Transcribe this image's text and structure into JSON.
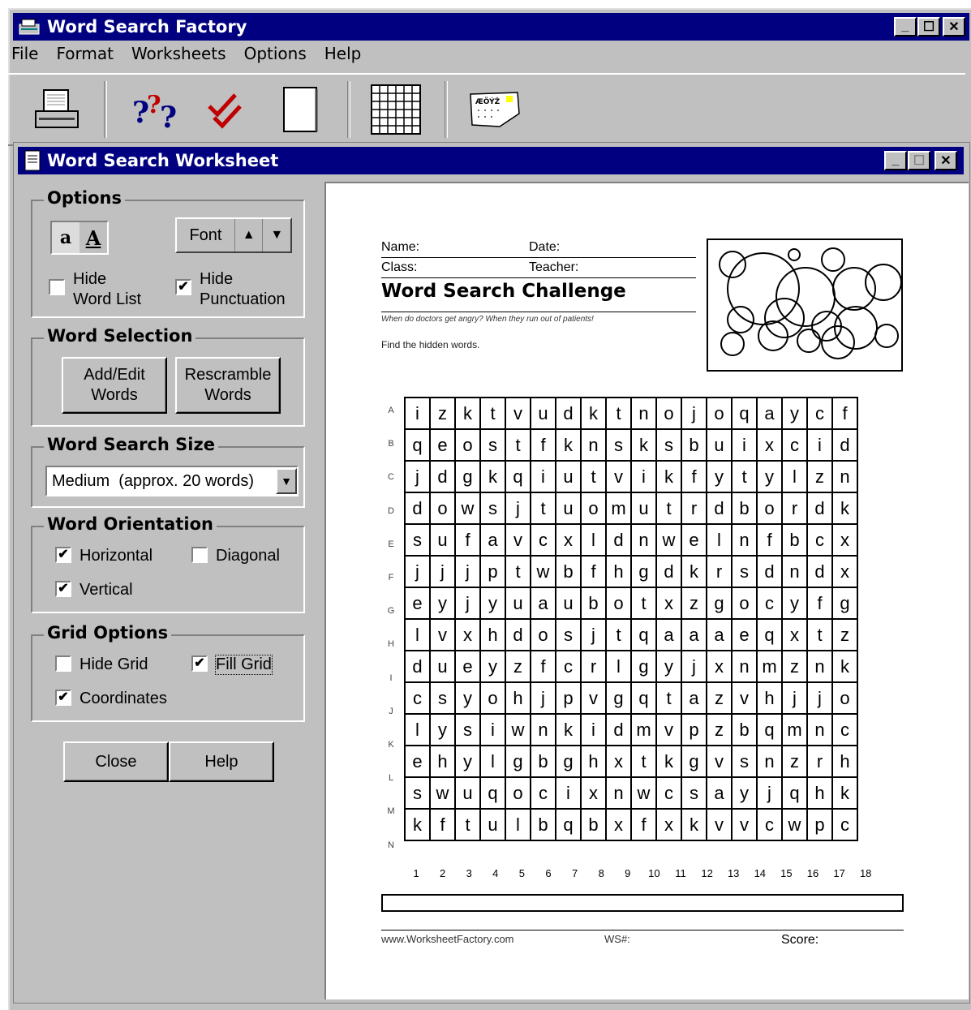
{
  "app": {
    "title": "Word Search Factory"
  },
  "menu": [
    "File",
    "Format",
    "Worksheets",
    "Options",
    "Help"
  ],
  "toolbar": {
    "buttons": [
      "printer-icon",
      "question-marks-icon",
      "checkmarks-icon",
      "blank-page-icon",
      "grid-icon",
      "worksheet-icon"
    ]
  },
  "worksheet_window": {
    "title": "Word Search Worksheet"
  },
  "options": {
    "group_label": "Options",
    "case_small": "a",
    "case_large": "A",
    "font_label": "Font",
    "hide_word_list": {
      "line1": "Hide",
      "line2": "Word List",
      "checked": false
    },
    "hide_punctuation": {
      "line1": "Hide",
      "line2": "Punctuation",
      "checked": true
    }
  },
  "word_selection": {
    "group_label": "Word Selection",
    "add_edit": {
      "line1": "Add/Edit",
      "line2": "Words"
    },
    "rescramble": {
      "line1": "Rescramble",
      "line2": "Words"
    }
  },
  "word_search_size": {
    "group_label": "Word Search Size",
    "selected": "Medium  (approx. 20 words)"
  },
  "word_orientation": {
    "group_label": "Word Orientation",
    "horizontal": {
      "label": "Horizontal",
      "checked": true
    },
    "diagonal": {
      "label": "Diagonal",
      "checked": false
    },
    "vertical": {
      "label": "Vertical",
      "checked": true
    }
  },
  "grid_options": {
    "group_label": "Grid Options",
    "hide_grid": {
      "label": "Hide Grid",
      "checked": false
    },
    "fill_grid": {
      "label": "Fill Grid",
      "checked": true
    },
    "coordinates": {
      "label": "Coordinates",
      "checked": true
    }
  },
  "bottom_buttons": {
    "close": "Close",
    "help": "Help"
  },
  "sheet": {
    "name_label": "Name:",
    "date_label": "Date:",
    "class_label": "Class:",
    "teacher_label": "Teacher:",
    "title": "Word Search Challenge",
    "subtitle": "When do doctors get angry? When they run out of patients!",
    "instructions": "Find the hidden words.",
    "footer_site": "www.WorksheetFactory.com",
    "footer_ws": "WS#:",
    "footer_score": "Score:",
    "row_labels": [
      "A",
      "B",
      "C",
      "D",
      "E",
      "F",
      "G",
      "H",
      "I",
      "J",
      "K",
      "L",
      "M",
      "N"
    ],
    "col_labels": [
      "1",
      "2",
      "3",
      "4",
      "5",
      "6",
      "7",
      "8",
      "9",
      "10",
      "11",
      "12",
      "13",
      "14",
      "15",
      "16",
      "17",
      "18"
    ],
    "grid": [
      [
        "i",
        "z",
        "k",
        "t",
        "v",
        "u",
        "d",
        "k",
        "t",
        "n",
        "o",
        "j",
        "o",
        "q",
        "a",
        "y",
        "c",
        "f"
      ],
      [
        "q",
        "e",
        "o",
        "s",
        "t",
        "f",
        "k",
        "n",
        "s",
        "k",
        "s",
        "b",
        "u",
        "i",
        "x",
        "c",
        "i",
        "d"
      ],
      [
        "j",
        "d",
        "g",
        "k",
        "q",
        "i",
        "u",
        "t",
        "v",
        "i",
        "k",
        "f",
        "y",
        "t",
        "y",
        "l",
        "z",
        "n"
      ],
      [
        "d",
        "o",
        "w",
        "s",
        "j",
        "t",
        "u",
        "o",
        "m",
        "u",
        "t",
        "r",
        "d",
        "b",
        "o",
        "r",
        "d",
        "k"
      ],
      [
        "s",
        "u",
        "f",
        "a",
        "v",
        "c",
        "x",
        "l",
        "d",
        "n",
        "w",
        "e",
        "l",
        "n",
        "f",
        "b",
        "c",
        "x"
      ],
      [
        "j",
        "j",
        "j",
        "p",
        "t",
        "w",
        "b",
        "f",
        "h",
        "g",
        "d",
        "k",
        "r",
        "s",
        "d",
        "n",
        "d",
        "x"
      ],
      [
        "e",
        "y",
        "j",
        "y",
        "u",
        "a",
        "u",
        "b",
        "o",
        "t",
        "x",
        "z",
        "g",
        "o",
        "c",
        "y",
        "f",
        "g"
      ],
      [
        "l",
        "v",
        "x",
        "h",
        "d",
        "o",
        "s",
        "j",
        "t",
        "q",
        "a",
        "a",
        "a",
        "e",
        "q",
        "x",
        "t",
        "z"
      ],
      [
        "d",
        "u",
        "e",
        "y",
        "z",
        "f",
        "c",
        "r",
        "l",
        "g",
        "y",
        "j",
        "x",
        "n",
        "m",
        "z",
        "n",
        "k"
      ],
      [
        "c",
        "s",
        "y",
        "o",
        "h",
        "j",
        "p",
        "v",
        "g",
        "q",
        "t",
        "a",
        "z",
        "v",
        "h",
        "j",
        "j",
        "o"
      ],
      [
        "l",
        "y",
        "s",
        "i",
        "w",
        "n",
        "k",
        "i",
        "d",
        "m",
        "v",
        "p",
        "z",
        "b",
        "q",
        "m",
        "n",
        "c"
      ],
      [
        "e",
        "h",
        "y",
        "l",
        "g",
        "b",
        "g",
        "h",
        "x",
        "t",
        "k",
        "g",
        "v",
        "s",
        "n",
        "z",
        "r",
        "h"
      ],
      [
        "s",
        "w",
        "u",
        "q",
        "o",
        "c",
        "i",
        "x",
        "n",
        "w",
        "c",
        "s",
        "a",
        "y",
        "j",
        "q",
        "h",
        "k"
      ],
      [
        "k",
        "f",
        "t",
        "u",
        "l",
        "b",
        "q",
        "b",
        "x",
        "f",
        "x",
        "k",
        "v",
        "v",
        "c",
        "w",
        "p",
        "c"
      ]
    ]
  }
}
